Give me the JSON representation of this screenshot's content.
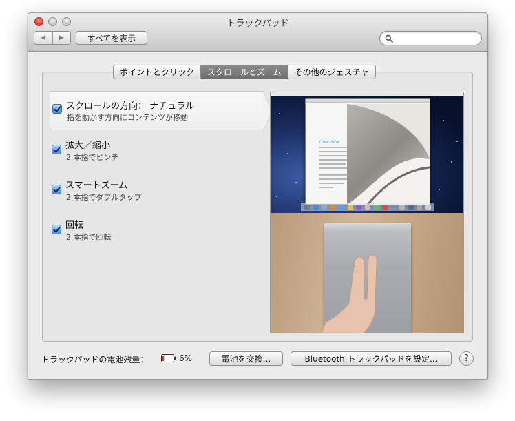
{
  "window": {
    "title": "トラックパッド"
  },
  "toolbar": {
    "back_icon": "back-arrow-icon",
    "forward_icon": "forward-arrow-icon",
    "show_all_label": "すべてを表示",
    "search_placeholder": "",
    "search_value": ""
  },
  "tabs": [
    {
      "label": "ポイントとクリック",
      "active": false
    },
    {
      "label": "スクロールとズーム",
      "active": true
    },
    {
      "label": "その他のジェスチャ",
      "active": false
    }
  ],
  "options": [
    {
      "title": "スクロールの方向： ナチュラル",
      "subtitle": "指を動かす方向にコンテンツが移動",
      "checked": true,
      "selected": true
    },
    {
      "title": "拡大／縮小",
      "subtitle": "2 本指でピンチ",
      "checked": true,
      "selected": false
    },
    {
      "title": "スマートズーム",
      "subtitle": "2 本指でダブルタップ",
      "checked": true,
      "selected": false
    },
    {
      "title": "回転",
      "subtitle": "2 本指で回転",
      "checked": true,
      "selected": false
    }
  ],
  "preview": {
    "doc_heading": "Overview"
  },
  "footer": {
    "battery_label": "トラックパッドの電池残量：",
    "battery_percent": "6%",
    "battery_level": 0.06,
    "replace_battery_button": "電池を交換...",
    "setup_button": "Bluetooth トラックパッドを設定...",
    "help_label": "?"
  },
  "colors": {
    "accent": "#4f8ee3",
    "battery_low": "#d63a2f",
    "tab_active": "#7a7a7a"
  }
}
